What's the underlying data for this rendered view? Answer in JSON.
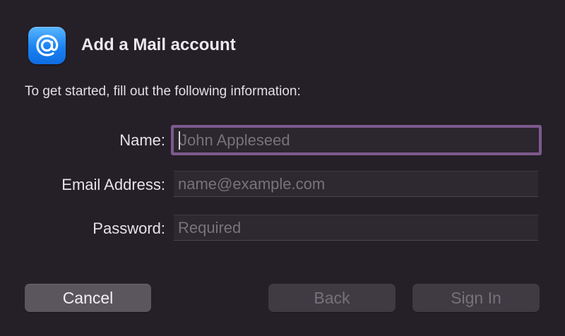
{
  "dialog": {
    "title": "Add a Mail account",
    "icon": "mail-at-icon",
    "instructions": "To get started, fill out the following information:"
  },
  "form": {
    "name": {
      "label": "Name:",
      "value": "",
      "placeholder": "John Appleseed"
    },
    "email": {
      "label": "Email Address:",
      "value": "",
      "placeholder": "name@example.com"
    },
    "password": {
      "label": "Password:",
      "value": "",
      "placeholder": "Required"
    }
  },
  "buttons": {
    "cancel": "Cancel",
    "back": "Back",
    "sign_in": "Sign In"
  },
  "colors": {
    "background": "#251f27",
    "focus_ring": "#7d5a8e",
    "icon_blue": "#1a82f2"
  }
}
